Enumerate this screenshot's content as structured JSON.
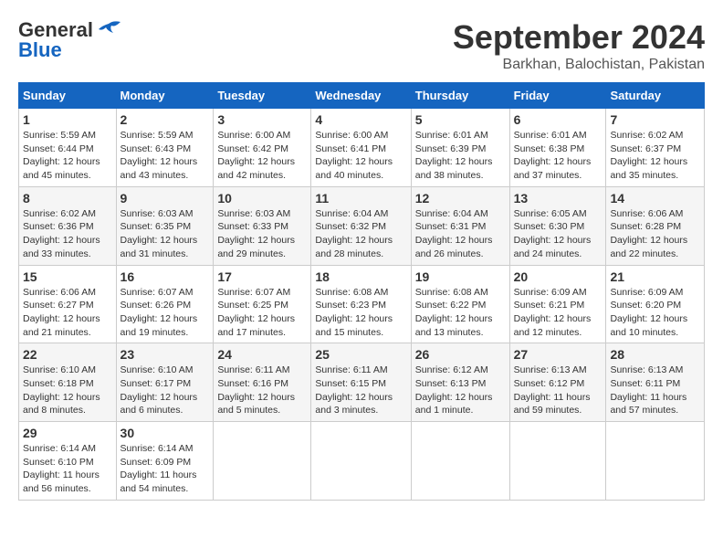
{
  "logo": {
    "line1": "General",
    "line2": "Blue"
  },
  "title": "September 2024",
  "subtitle": "Barkhan, Balochistan, Pakistan",
  "days_of_week": [
    "Sunday",
    "Monday",
    "Tuesday",
    "Wednesday",
    "Thursday",
    "Friday",
    "Saturday"
  ],
  "weeks": [
    [
      {
        "day": "1",
        "sunrise": "Sunrise: 5:59 AM",
        "sunset": "Sunset: 6:44 PM",
        "daylight": "Daylight: 12 hours and 45 minutes."
      },
      {
        "day": "2",
        "sunrise": "Sunrise: 5:59 AM",
        "sunset": "Sunset: 6:43 PM",
        "daylight": "Daylight: 12 hours and 43 minutes."
      },
      {
        "day": "3",
        "sunrise": "Sunrise: 6:00 AM",
        "sunset": "Sunset: 6:42 PM",
        "daylight": "Daylight: 12 hours and 42 minutes."
      },
      {
        "day": "4",
        "sunrise": "Sunrise: 6:00 AM",
        "sunset": "Sunset: 6:41 PM",
        "daylight": "Daylight: 12 hours and 40 minutes."
      },
      {
        "day": "5",
        "sunrise": "Sunrise: 6:01 AM",
        "sunset": "Sunset: 6:39 PM",
        "daylight": "Daylight: 12 hours and 38 minutes."
      },
      {
        "day": "6",
        "sunrise": "Sunrise: 6:01 AM",
        "sunset": "Sunset: 6:38 PM",
        "daylight": "Daylight: 12 hours and 37 minutes."
      },
      {
        "day": "7",
        "sunrise": "Sunrise: 6:02 AM",
        "sunset": "Sunset: 6:37 PM",
        "daylight": "Daylight: 12 hours and 35 minutes."
      }
    ],
    [
      {
        "day": "8",
        "sunrise": "Sunrise: 6:02 AM",
        "sunset": "Sunset: 6:36 PM",
        "daylight": "Daylight: 12 hours and 33 minutes."
      },
      {
        "day": "9",
        "sunrise": "Sunrise: 6:03 AM",
        "sunset": "Sunset: 6:35 PM",
        "daylight": "Daylight: 12 hours and 31 minutes."
      },
      {
        "day": "10",
        "sunrise": "Sunrise: 6:03 AM",
        "sunset": "Sunset: 6:33 PM",
        "daylight": "Daylight: 12 hours and 29 minutes."
      },
      {
        "day": "11",
        "sunrise": "Sunrise: 6:04 AM",
        "sunset": "Sunset: 6:32 PM",
        "daylight": "Daylight: 12 hours and 28 minutes."
      },
      {
        "day": "12",
        "sunrise": "Sunrise: 6:04 AM",
        "sunset": "Sunset: 6:31 PM",
        "daylight": "Daylight: 12 hours and 26 minutes."
      },
      {
        "day": "13",
        "sunrise": "Sunrise: 6:05 AM",
        "sunset": "Sunset: 6:30 PM",
        "daylight": "Daylight: 12 hours and 24 minutes."
      },
      {
        "day": "14",
        "sunrise": "Sunrise: 6:06 AM",
        "sunset": "Sunset: 6:28 PM",
        "daylight": "Daylight: 12 hours and 22 minutes."
      }
    ],
    [
      {
        "day": "15",
        "sunrise": "Sunrise: 6:06 AM",
        "sunset": "Sunset: 6:27 PM",
        "daylight": "Daylight: 12 hours and 21 minutes."
      },
      {
        "day": "16",
        "sunrise": "Sunrise: 6:07 AM",
        "sunset": "Sunset: 6:26 PM",
        "daylight": "Daylight: 12 hours and 19 minutes."
      },
      {
        "day": "17",
        "sunrise": "Sunrise: 6:07 AM",
        "sunset": "Sunset: 6:25 PM",
        "daylight": "Daylight: 12 hours and 17 minutes."
      },
      {
        "day": "18",
        "sunrise": "Sunrise: 6:08 AM",
        "sunset": "Sunset: 6:23 PM",
        "daylight": "Daylight: 12 hours and 15 minutes."
      },
      {
        "day": "19",
        "sunrise": "Sunrise: 6:08 AM",
        "sunset": "Sunset: 6:22 PM",
        "daylight": "Daylight: 12 hours and 13 minutes."
      },
      {
        "day": "20",
        "sunrise": "Sunrise: 6:09 AM",
        "sunset": "Sunset: 6:21 PM",
        "daylight": "Daylight: 12 hours and 12 minutes."
      },
      {
        "day": "21",
        "sunrise": "Sunrise: 6:09 AM",
        "sunset": "Sunset: 6:20 PM",
        "daylight": "Daylight: 12 hours and 10 minutes."
      }
    ],
    [
      {
        "day": "22",
        "sunrise": "Sunrise: 6:10 AM",
        "sunset": "Sunset: 6:18 PM",
        "daylight": "Daylight: 12 hours and 8 minutes."
      },
      {
        "day": "23",
        "sunrise": "Sunrise: 6:10 AM",
        "sunset": "Sunset: 6:17 PM",
        "daylight": "Daylight: 12 hours and 6 minutes."
      },
      {
        "day": "24",
        "sunrise": "Sunrise: 6:11 AM",
        "sunset": "Sunset: 6:16 PM",
        "daylight": "Daylight: 12 hours and 5 minutes."
      },
      {
        "day": "25",
        "sunrise": "Sunrise: 6:11 AM",
        "sunset": "Sunset: 6:15 PM",
        "daylight": "Daylight: 12 hours and 3 minutes."
      },
      {
        "day": "26",
        "sunrise": "Sunrise: 6:12 AM",
        "sunset": "Sunset: 6:13 PM",
        "daylight": "Daylight: 12 hours and 1 minute."
      },
      {
        "day": "27",
        "sunrise": "Sunrise: 6:13 AM",
        "sunset": "Sunset: 6:12 PM",
        "daylight": "Daylight: 11 hours and 59 minutes."
      },
      {
        "day": "28",
        "sunrise": "Sunrise: 6:13 AM",
        "sunset": "Sunset: 6:11 PM",
        "daylight": "Daylight: 11 hours and 57 minutes."
      }
    ],
    [
      {
        "day": "29",
        "sunrise": "Sunrise: 6:14 AM",
        "sunset": "Sunset: 6:10 PM",
        "daylight": "Daylight: 11 hours and 56 minutes."
      },
      {
        "day": "30",
        "sunrise": "Sunrise: 6:14 AM",
        "sunset": "Sunset: 6:09 PM",
        "daylight": "Daylight: 11 hours and 54 minutes."
      },
      null,
      null,
      null,
      null,
      null
    ]
  ]
}
